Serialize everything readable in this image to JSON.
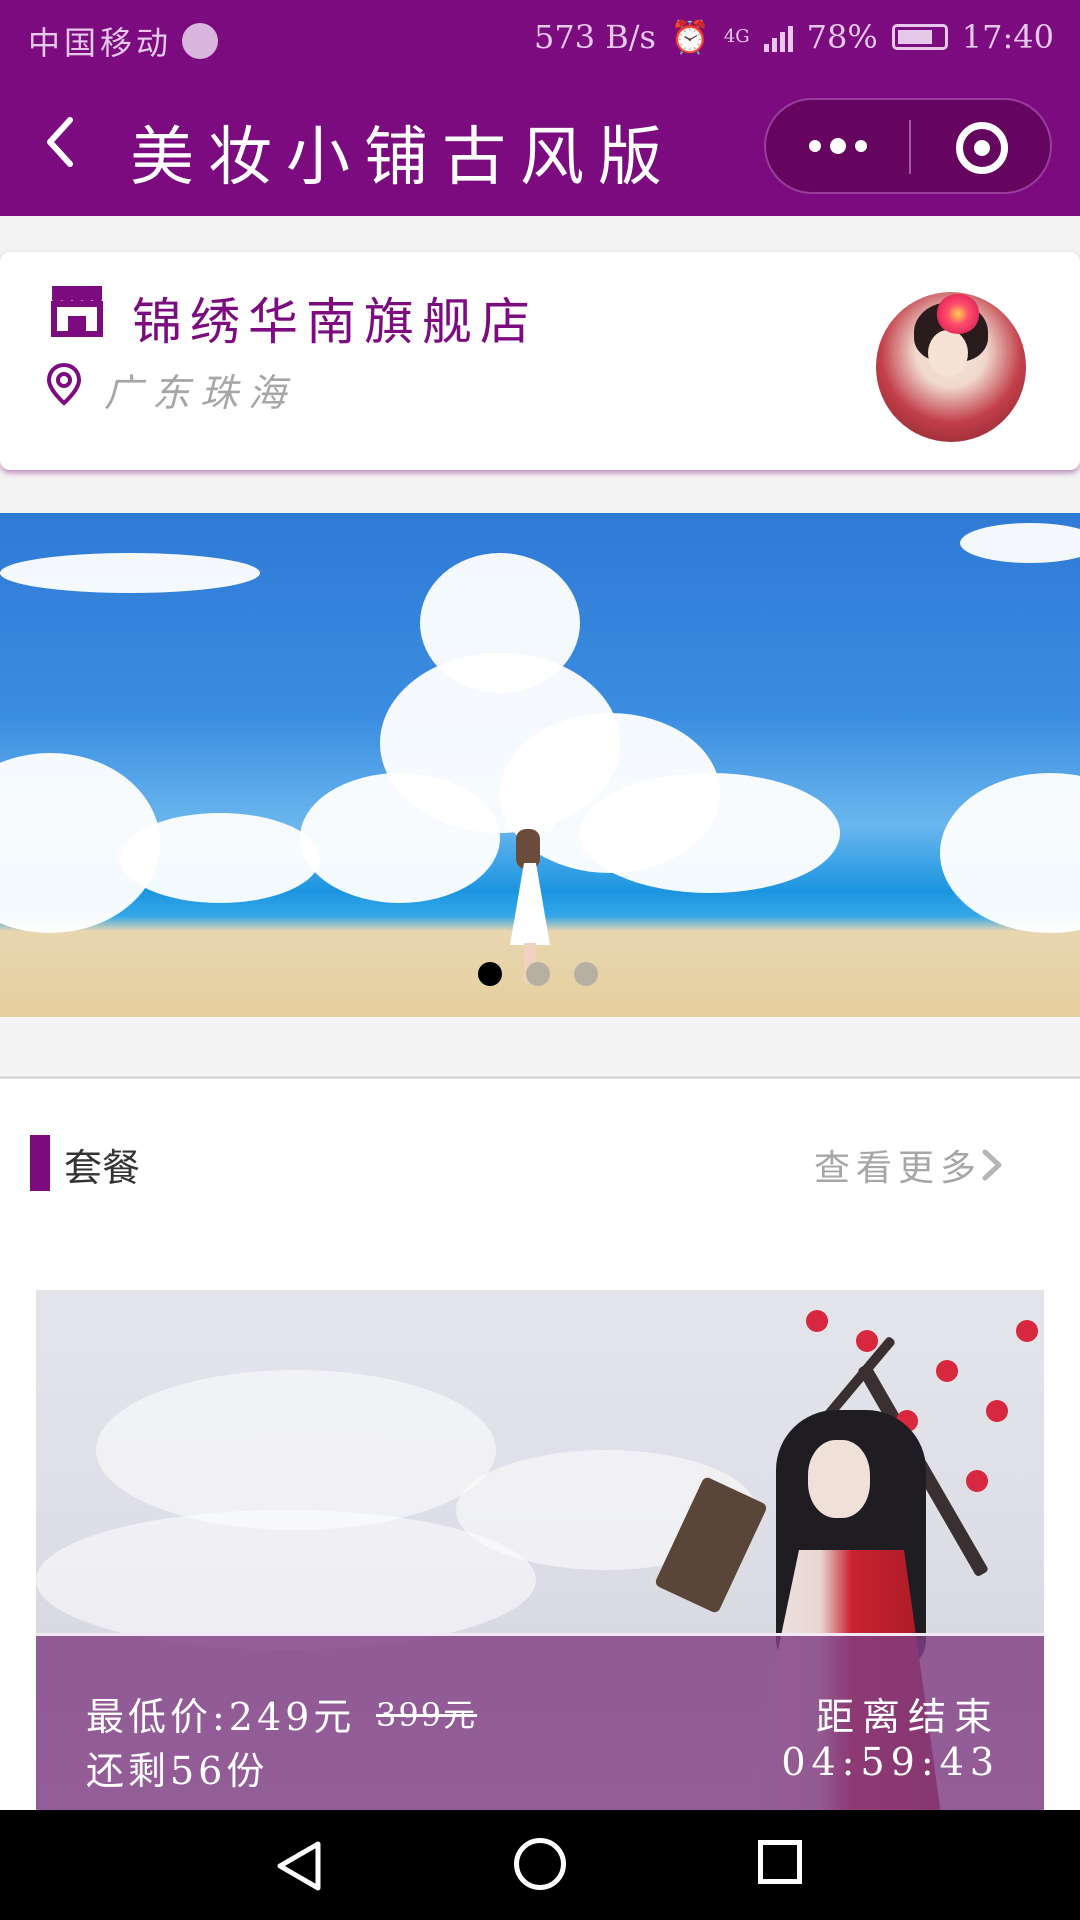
{
  "status_bar": {
    "carrier": "中国移动",
    "speed": "573 B/s",
    "network": "4G",
    "battery": "78%",
    "battery_level": 0.78,
    "time": "17:40"
  },
  "nav": {
    "title": "美妆小铺古风版"
  },
  "shop": {
    "name": "锦绣华南旗舰店",
    "location": "广东珠海"
  },
  "banner": {
    "slide_count": 3,
    "active_index": 0
  },
  "section": {
    "title": "套餐",
    "more_label": "查看更多"
  },
  "package": {
    "price_label": "最低价:249元",
    "original_price": "399元",
    "remaining": "还剩56份",
    "countdown_label": "距离结束",
    "countdown": "04:59:43"
  },
  "colors": {
    "brand": "#7b0b7f",
    "overlay": "#803e84"
  },
  "icons": {
    "back": "chevron-left-icon",
    "more": "more-dots-icon",
    "target": "target-icon",
    "shop": "store-icon",
    "location": "map-pin-icon",
    "more_arrow": "chevron-right-icon"
  }
}
